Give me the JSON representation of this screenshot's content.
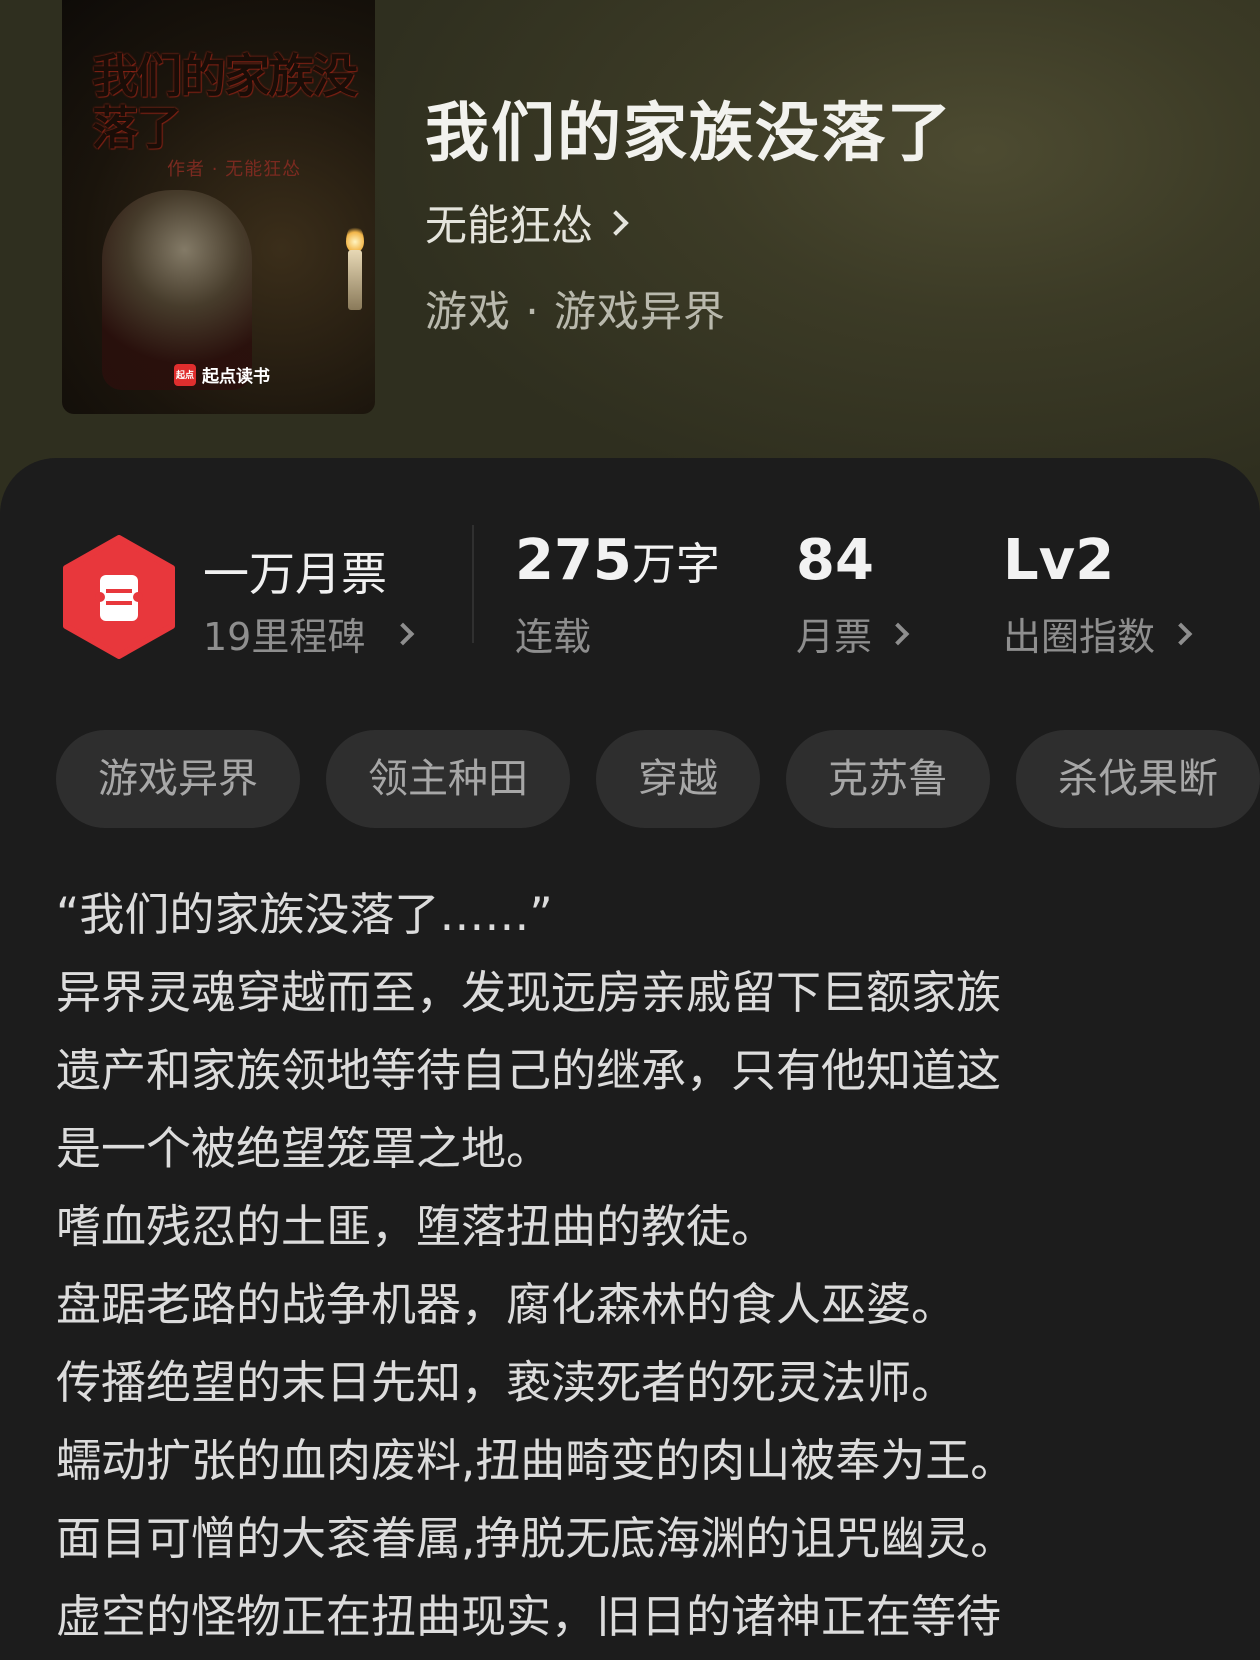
{
  "header": {
    "cover": {
      "title": "我们的家族没落了",
      "author_line": "作者 · 无能狂怂",
      "brand": "起点读书",
      "brand_logo": "起点"
    },
    "title": "我们的家族没落了",
    "author": "无能狂怂",
    "genre": "游戏 · 游戏异界"
  },
  "stats": {
    "milestone": {
      "icon": "ticket-badge-icon",
      "value": "一万月票",
      "sub": "19里程碑"
    },
    "word_count": {
      "number": "275",
      "unit": "万字",
      "label": "连载"
    },
    "monthly_tickets": {
      "number": "84",
      "label": "月票"
    },
    "popularity": {
      "number": "Lv2",
      "label": "出圈指数"
    }
  },
  "tags": [
    "游戏异界",
    "领主种田",
    "穿越",
    "克苏鲁",
    "杀伐果断"
  ],
  "summary": [
    "“我们的家族没落了……”",
    "异界灵魂穿越而至，发现远房亲戚留下巨额家族",
    "遗产和家族领地等待自己的继承，只有他知道这",
    "是一个被绝望笼罩之地。",
    "嗜血残忍的土匪，堕落扭曲的教徒。",
    "盘踞老路的战争机器，腐化森林的食人巫婆。",
    "传播绝望的末日先知，亵渎死者的死灵法师。",
    "蠕动扩张的血肉废料,扭曲畸变的肉山被奉为王。",
    "面目可憎的大衮眷属,挣脱无底海渊的诅咒幽灵。",
    "虚空的怪物正在扭曲现实，旧日的诸神正在等待"
  ],
  "colors": {
    "hero_bg": "#3c3b26",
    "panel_bg": "#1c1c1c",
    "badge_red": "#e8373c",
    "tag_bg": "#2e2e2e"
  }
}
